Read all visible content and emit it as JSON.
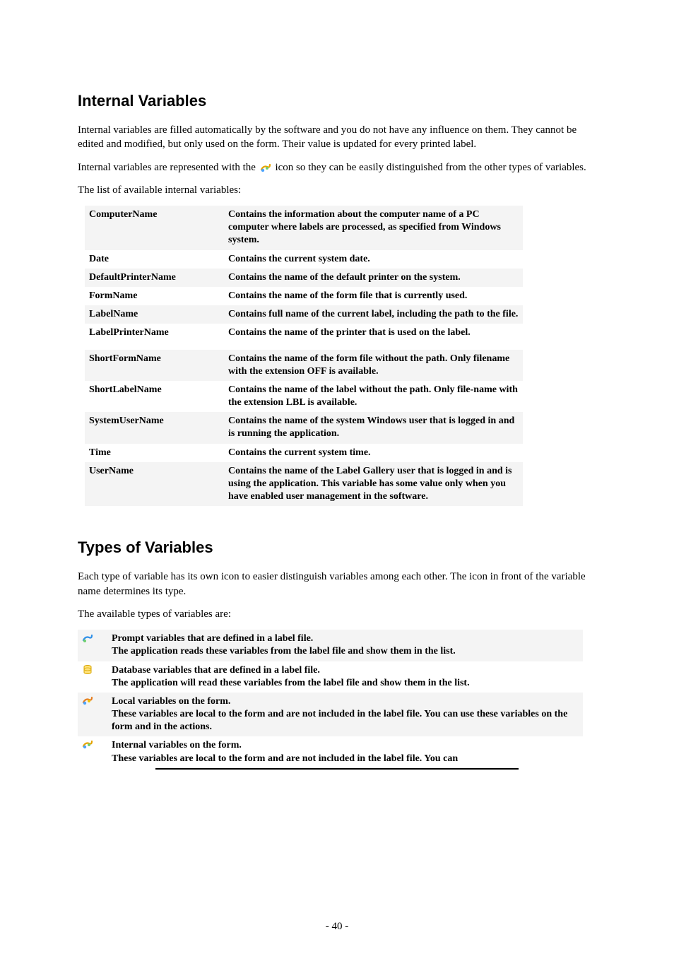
{
  "section1": {
    "heading": "Internal Variables",
    "para1": "Internal variables are filled automatically by the software and you do not have any influence on them. They cannot be edited and modified, but only used on the form. Their value is updated for every printed label.",
    "para2a": "Internal variables are represented with the ",
    "para2b": " icon so they can be easily distinguished from the other types of variables.",
    "para3": "The list of available internal variables:",
    "rows": [
      {
        "name": "ComputerName",
        "desc": "Contains the information about the computer name of a PC computer where labels are processed, as specified from Windows system."
      },
      {
        "name": "Date",
        "desc": "Contains the current system date."
      },
      {
        "name": "DefaultPrinterName",
        "desc": "Contains the name of the default printer on the system."
      },
      {
        "name": "FormName",
        "desc": "Contains the name of the form file that is currently used."
      },
      {
        "name": "LabelName",
        "desc": "Contains full name of the current label, including the path to the file."
      },
      {
        "name": "LabelPrinterName",
        "desc": "Contains the name of the printer that is used on the label."
      },
      {
        "name": "ShortFormName",
        "desc": "Contains the name of the form file without the path. Only filename with the extension OFF is available."
      },
      {
        "name": "ShortLabelName",
        "desc": "Contains the name of the label without the path. Only file-name with the extension LBL is available."
      },
      {
        "name": "SystemUserName",
        "desc": "Contains the name of the system Windows user that is logged in and is running the application."
      },
      {
        "name": "Time",
        "desc": "Contains the current system time."
      },
      {
        "name": "UserName",
        "desc": "Contains the name of the Label Gallery user that is logged in and is using the application. This variable has some value only when you have enabled user management in the software."
      }
    ]
  },
  "section2": {
    "heading": "Types of Variables",
    "para1": "Each type of variable has its own icon to easier distinguish variables among each other. The icon in front of the variable name determines its type.",
    "para2": "The available types of variables are:",
    "rows": [
      {
        "icon": "prompt-variable-icon",
        "line1": "Prompt variables that are defined in a label file.",
        "line2": " The application reads these variables from the label file and show them in the list."
      },
      {
        "icon": "database-variable-icon",
        "line1": "Database variables that are defined in a label file.",
        "line2": " The application will read these variables from the label file and show them in the list."
      },
      {
        "icon": "local-variable-icon",
        "line1": "Local variables on the form.",
        "line2": " These variables are local to the form and are not included in the label file. You can use these variables on the form and in the actions."
      },
      {
        "icon": "internal-variable-icon",
        "line1": "Internal variables on the form.",
        "line2": " These variables are local to the form and are not included in the label file. You can"
      }
    ]
  },
  "footer": {
    "pagenum": "- 40 -"
  }
}
